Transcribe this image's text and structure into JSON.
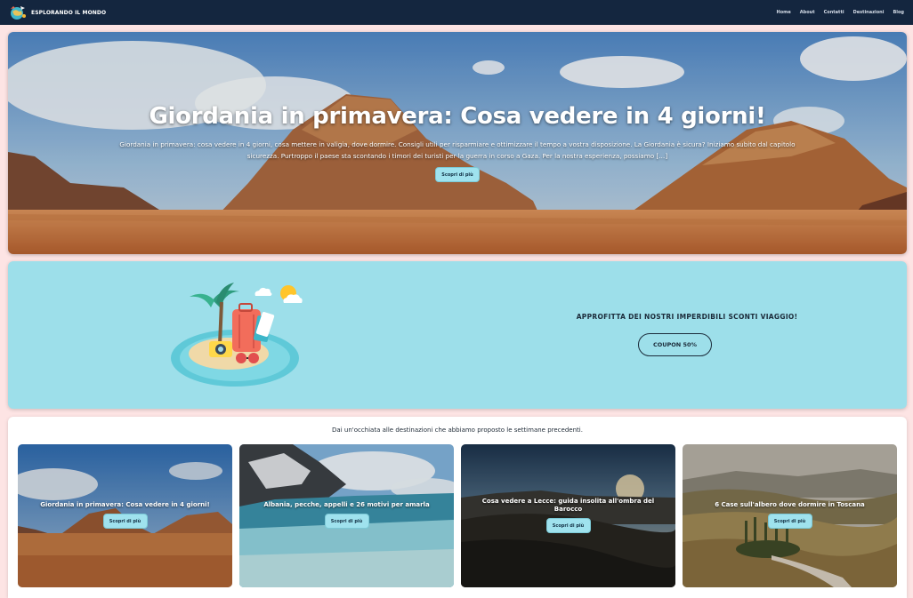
{
  "navbar": {
    "brand": "ESPLORANDO IL MONDO",
    "links": [
      "Home",
      "About",
      "Contatti",
      "Destinazioni",
      "Blog"
    ]
  },
  "hero": {
    "title": "Giordania in primavera: Cosa vedere in 4 giorni!",
    "excerpt": "Giordania in primavera: cosa vedere in 4 giorni, cosa mettere in valigia, dove dormire. Consigli utili per risparmiare e ottimizzare il tempo a vostra disposizione. La Giordania è sicura? Iniziamo subito dal capitolo sicurezza. Purtroppo il paese sta scontando i timori dei turisti per la guerra in corso a Gaza. Per la nostra esperienza, possiamo […]",
    "button": "Scopri di più"
  },
  "promo": {
    "text": "APPROFITTA DEI NOSTRI IMPERDIBILI SCONTI VIAGGIO!",
    "coupon": "COUPON 50%"
  },
  "destinations": {
    "heading": "Dai un'occhiata alle destinazioni che abbiamo proposto le settimane precedenti.",
    "cards": [
      {
        "title": "Giordania in primavera: Cosa vedere in 4 giorni!",
        "button": "Scopri di più"
      },
      {
        "title": "Albania, pecche, appelli e 26 motivi per amarla",
        "button": "Scopri di più"
      },
      {
        "title": "Cosa vedere a Lecce: guida insolita all'ombra del Barocco",
        "button": "Scopri di più"
      },
      {
        "title": "6 Case sull'albero dove dormire in Toscana",
        "button": "Scopri di più"
      }
    ]
  },
  "colors": {
    "navbar": "#14263f",
    "page_background": "#fde4e4",
    "promo_background": "#9ddfea",
    "button": "#9fe2ee"
  }
}
